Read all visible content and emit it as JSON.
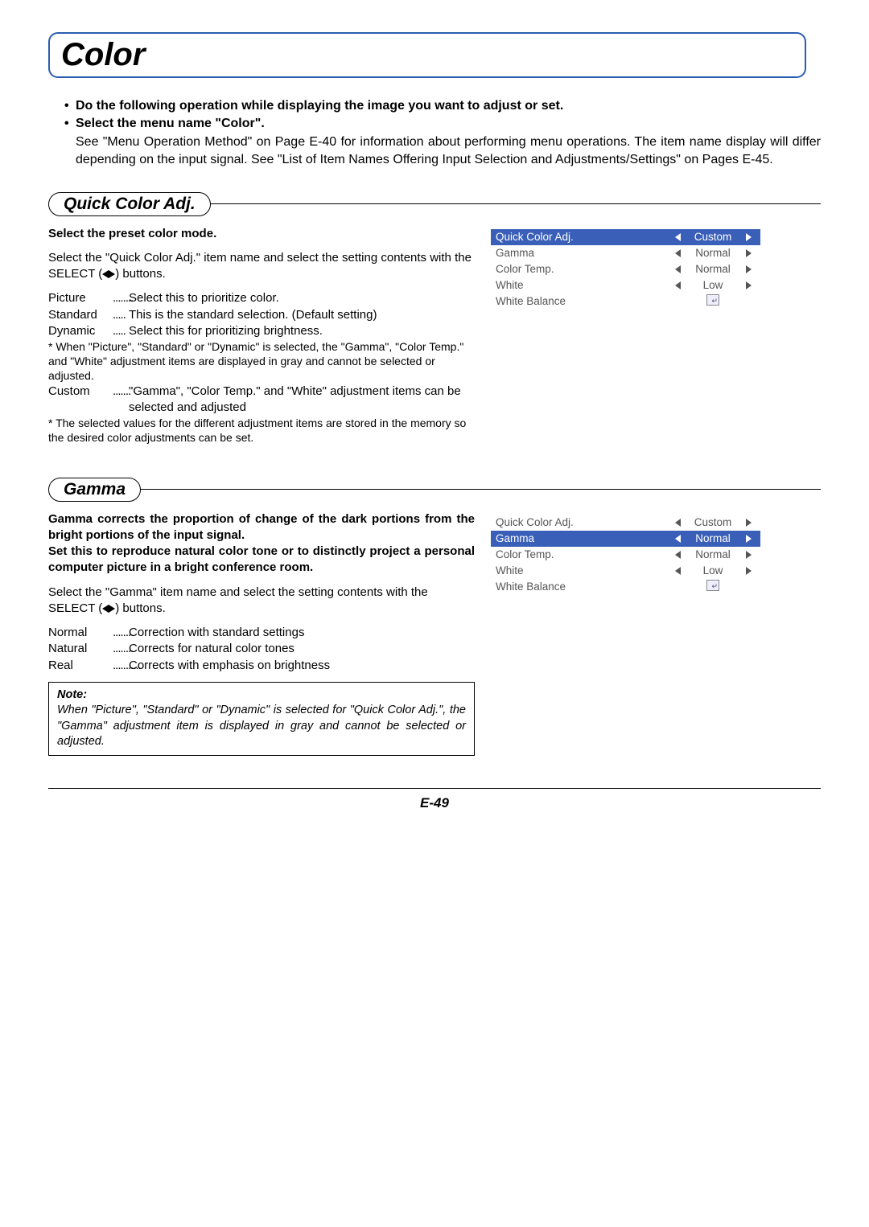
{
  "title": "Color",
  "intro": {
    "bullet1": "Do the following operation while displaying the image you want to adjust or set.",
    "bullet2": "Select the menu name \"Color\".",
    "para": "See \"Menu Operation Method\" on Page E-40 for information about performing menu operations. The item name display will differ depending on the input signal. See \"List of Item Names Offering Input Selection and Adjustments/Settings\" on Pages E-45."
  },
  "section1": {
    "heading": "Quick Color Adj.",
    "sub_bold": "Select the preset color mode.",
    "para1a": "Select the \"Quick Color Adj.\" item name and select the setting contents with the SELECT (",
    "para1b": ") buttons.",
    "opts": [
      {
        "term": "Picture",
        "dots": "........",
        "desc": "Select this to prioritize color."
      },
      {
        "term": "Standard",
        "dots": ".....",
        "desc": "This is the standard selection. (Default setting)"
      },
      {
        "term": "Dynamic",
        "dots": ".....",
        "desc": "Select this for prioritizing brightness."
      }
    ],
    "foot1": "* When \"Picture\", \"Standard\" or \"Dynamic\" is selected, the \"Gamma\", \"Color Temp.\" and \"White\" adjustment items are displayed in gray and cannot be selected or adjusted.",
    "custom_term": "Custom",
    "custom_dots": ".......",
    "custom_desc": "\"Gamma\", \"Color Temp.\" and \"White\" adjustment items can be selected and adjusted",
    "foot2": "* The selected values for the different adjustment items are stored in the memory so the desired color adjustments can be set.",
    "menu": {
      "selected_index": 0,
      "rows": [
        {
          "label": "Quick Color Adj.",
          "value": "Custom",
          "arrows": true
        },
        {
          "label": "Gamma",
          "value": "Normal",
          "arrows": true
        },
        {
          "label": "Color Temp.",
          "value": "Normal",
          "arrows": true
        },
        {
          "label": "White",
          "value": "Low",
          "arrows": true
        },
        {
          "label": "White Balance",
          "value": "",
          "arrows": false,
          "icon": true
        }
      ]
    }
  },
  "section2": {
    "heading": "Gamma",
    "sub_bold": "Gamma corrects the proportion of change of the dark portions from the bright portions of the input signal.\nSet this to reproduce natural color tone or to distinctly project a personal computer picture in a bright conference room.",
    "para1a": "Select the \"Gamma\" item name and select the setting contents with the SELECT (",
    "para1b": ") buttons.",
    "opts": [
      {
        "term": "Normal",
        "dots": ".......",
        "desc": "Correction with standard settings"
      },
      {
        "term": "Natural",
        "dots": "........",
        "desc": "Corrects for natural color tones"
      },
      {
        "term": "Real",
        "dots": "...........",
        "desc": "Corrects with emphasis on brightness"
      }
    ],
    "note_title": "Note:",
    "note_body": "When \"Picture\", \"Standard\" or \"Dynamic\" is selected for \"Quick Color Adj.\", the \"Gamma\" adjustment item is displayed in gray and cannot be selected or adjusted.",
    "menu": {
      "selected_index": 1,
      "rows": [
        {
          "label": "Quick Color Adj.",
          "value": "Custom",
          "arrows": true
        },
        {
          "label": "Gamma",
          "value": "Normal",
          "arrows": true
        },
        {
          "label": "Color Temp.",
          "value": "Normal",
          "arrows": true
        },
        {
          "label": "White",
          "value": "Low",
          "arrows": true
        },
        {
          "label": "White Balance",
          "value": "",
          "arrows": false,
          "icon": true
        }
      ]
    }
  },
  "page_number": "E-49"
}
